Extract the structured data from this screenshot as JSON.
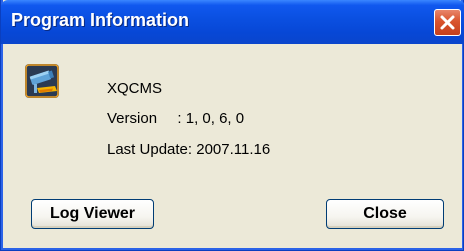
{
  "window": {
    "title": "Program Information"
  },
  "app": {
    "name": "XQCMS",
    "version_label": "Version",
    "version_sep": ": 1, 0, 6, 0",
    "update_label": "Last Update:",
    "update_value": "2007.11.16",
    "icon": "cctv-camera-icon"
  },
  "buttons": {
    "log_viewer": "Log Viewer",
    "close": "Close"
  },
  "colors": {
    "title_bar": "#0a4fe0",
    "close_x": "#d9542e",
    "dialog_bg": "#ece9d8"
  }
}
